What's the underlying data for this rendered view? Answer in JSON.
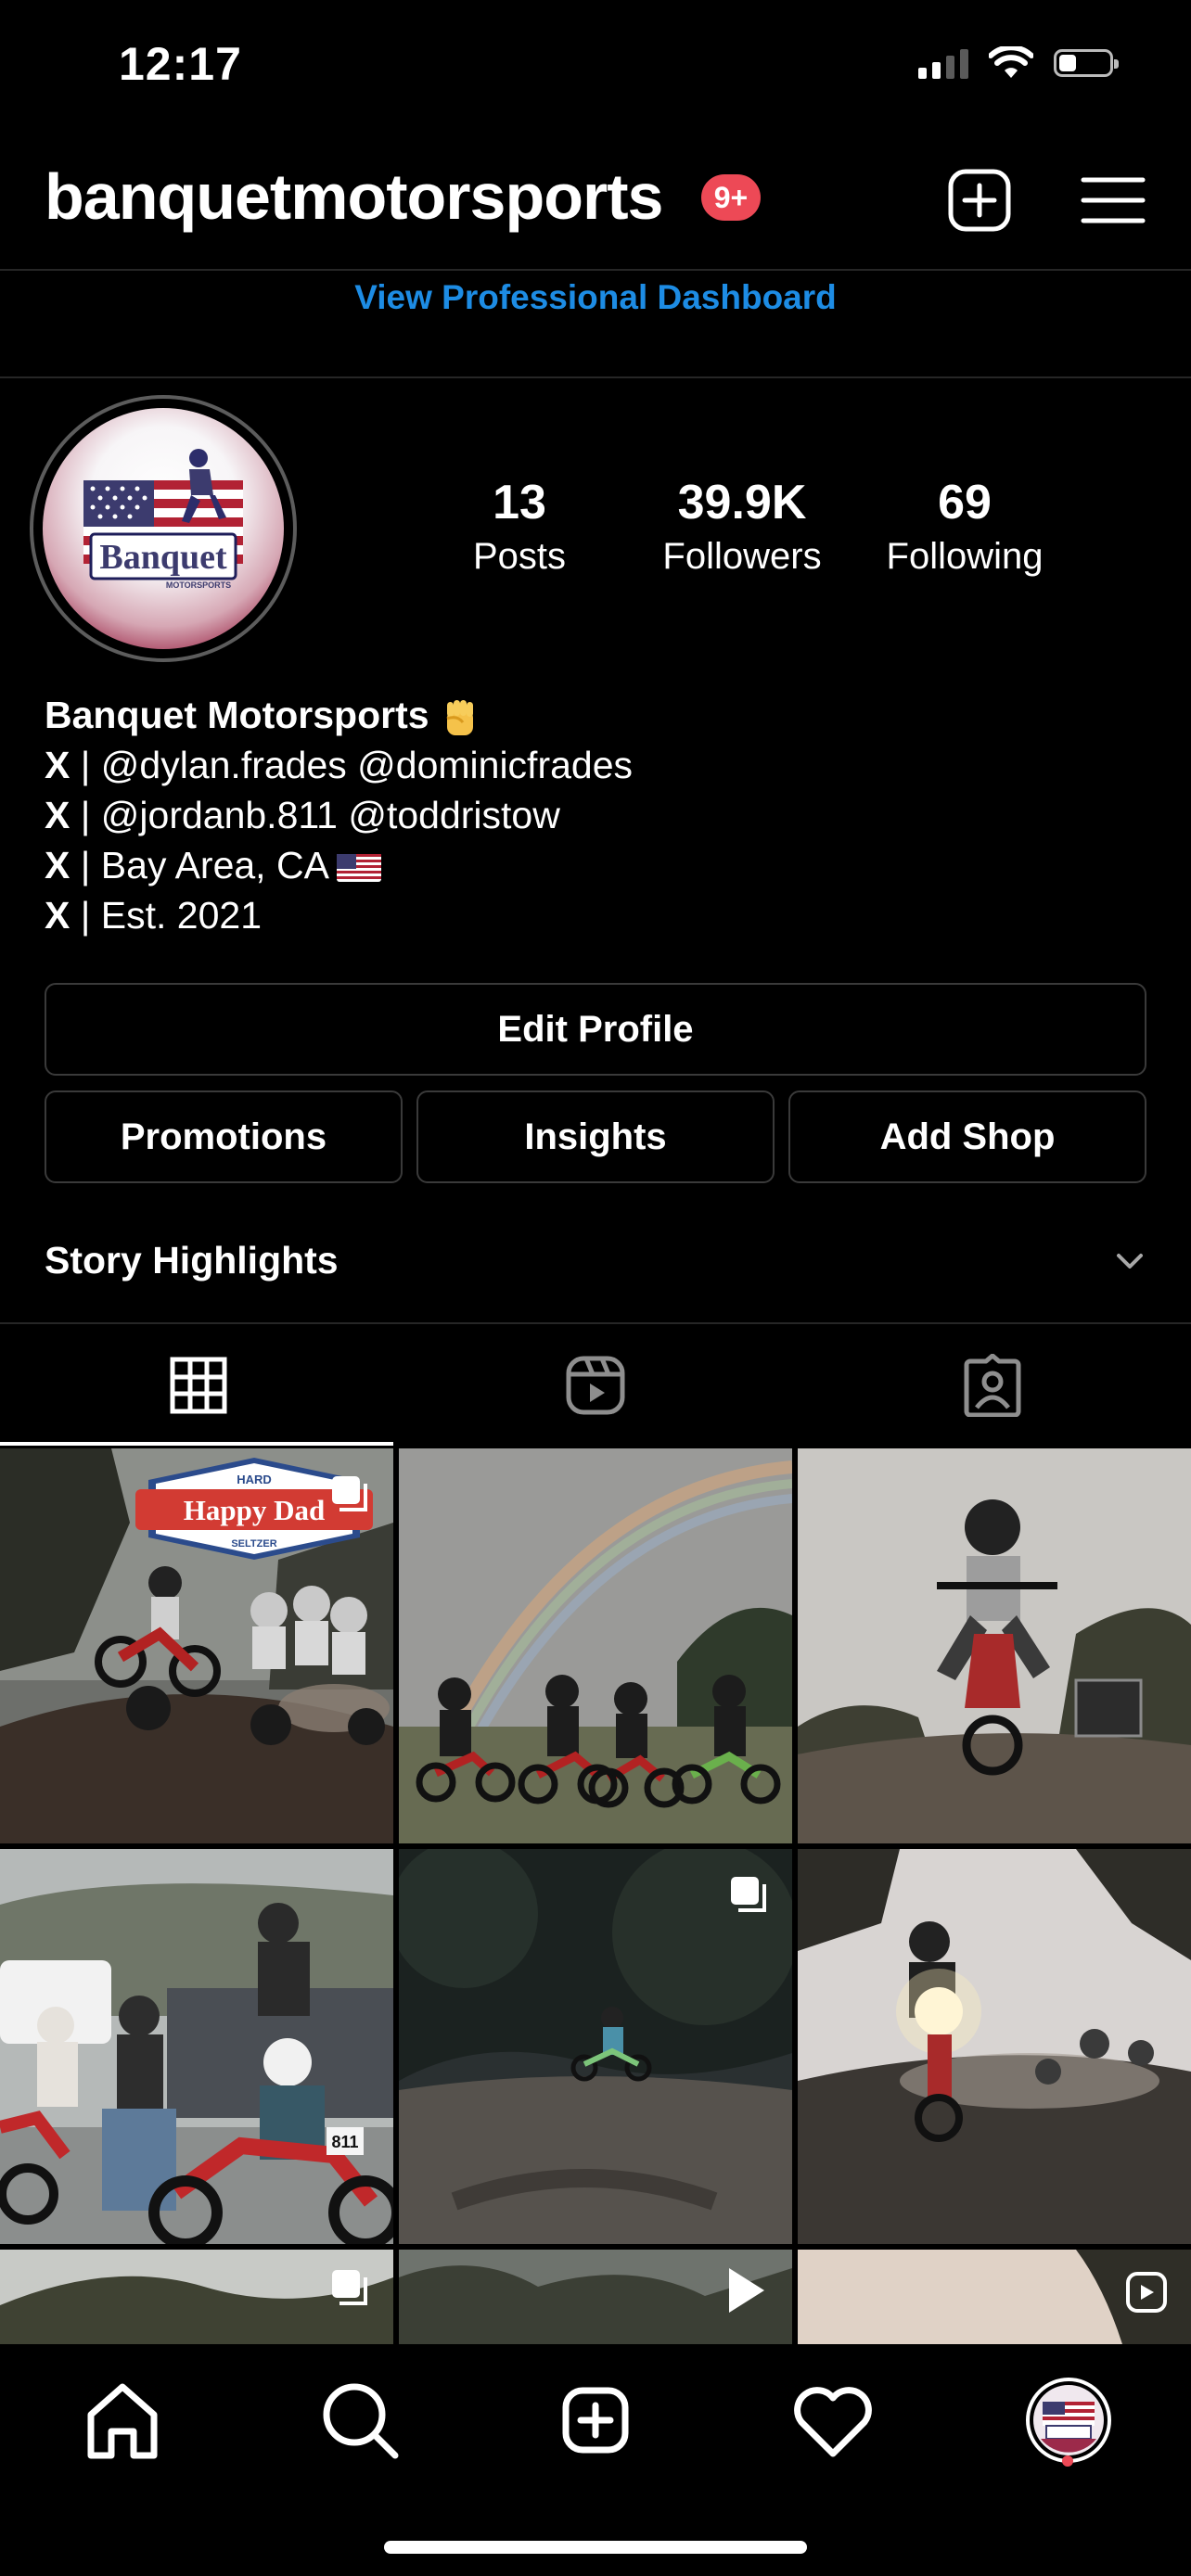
{
  "status_bar": {
    "time": "12:17",
    "signal_bars_on": 2,
    "signal_bars_total": 4,
    "battery_level": 0.35
  },
  "header": {
    "username": "banquetmotorsports",
    "notification_badge": "9+"
  },
  "pro_dashboard_link": "View Professional Dashboard",
  "avatar": {
    "logo_text": "Banquet",
    "logo_subtext": "MOTORSPORTS"
  },
  "stats": [
    {
      "value": "13",
      "label": "Posts"
    },
    {
      "value": "39.9K",
      "label": "Followers"
    },
    {
      "value": "69",
      "label": "Following"
    }
  ],
  "bio": {
    "name": "Banquet Motorsports",
    "lines": [
      {
        "prefix": "X",
        "text": " | @dylan.frades @dominicfrades"
      },
      {
        "prefix": "X",
        "text": " | @jordanb.811 @toddristow"
      },
      {
        "prefix": "X",
        "text": " | Bay Area, CA"
      },
      {
        "prefix": "X",
        "text": " | Est. 2021"
      }
    ]
  },
  "buttons": {
    "edit_profile": "Edit Profile",
    "promotions": "Promotions",
    "insights": "Insights",
    "add_shop": "Add Shop"
  },
  "story_highlights": "Story Highlights",
  "tabs": [
    {
      "icon": "grid-icon",
      "selected": true
    },
    {
      "icon": "reels-icon",
      "selected": false
    },
    {
      "icon": "tagged-icon",
      "selected": false
    }
  ],
  "posts": [
    {
      "kind": "carousel",
      "scene": "rider-jump-with-sign",
      "sign": {
        "top": "HARD",
        "main": "Happy Dad",
        "bottom": "SELTZER"
      }
    },
    {
      "kind": "photo",
      "scene": "riders-under-rainbow"
    },
    {
      "kind": "photo",
      "scene": "rider-jump-close"
    },
    {
      "kind": "photo",
      "scene": "group-at-truck",
      "bike_number": "811"
    },
    {
      "kind": "carousel",
      "scene": "rider-in-woods"
    },
    {
      "kind": "photo",
      "scene": "rider-headlight-jump"
    },
    {
      "kind": "carousel",
      "scene": "partial-trees"
    },
    {
      "kind": "reel",
      "scene": "partial-forest"
    },
    {
      "kind": "reel",
      "scene": "partial-sunset"
    }
  ],
  "colors": {
    "accent_link": "#1d8ce4",
    "badge": "#ed4956",
    "background": "#000000",
    "divider": "#262626"
  },
  "bottom_nav": [
    "home-icon",
    "search-icon",
    "create-icon",
    "activity-heart-icon",
    "profile-avatar"
  ]
}
